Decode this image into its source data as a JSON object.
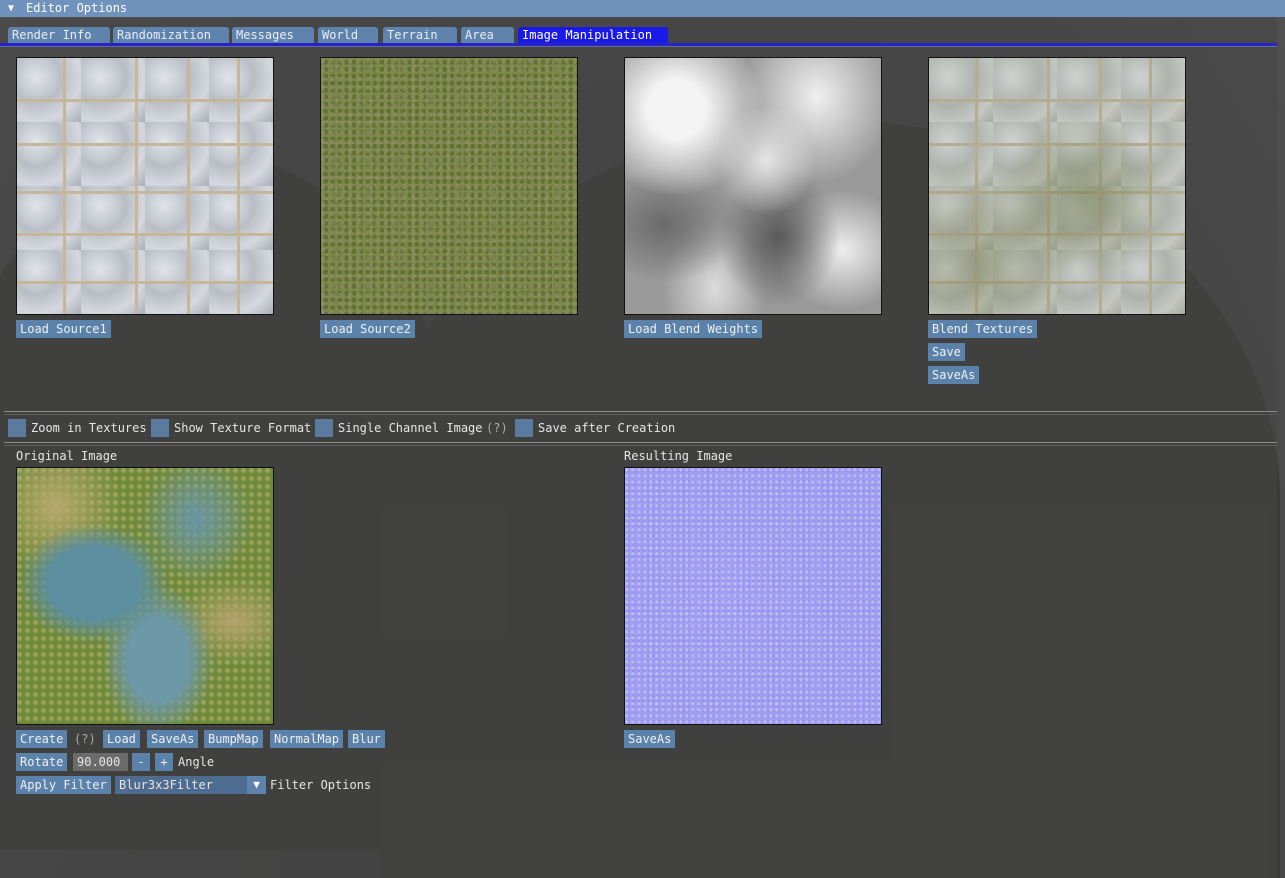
{
  "window": {
    "title": "Editor Options"
  },
  "tabs": [
    {
      "label": "Render Info",
      "active": false
    },
    {
      "label": "Randomization",
      "active": false
    },
    {
      "label": "Messages",
      "active": false
    },
    {
      "label": "World",
      "active": false
    },
    {
      "label": "Terrain",
      "active": false
    },
    {
      "label": "Area",
      "active": false
    },
    {
      "label": "Image Manipulation",
      "active": true
    }
  ],
  "blend": {
    "load_source1": "Load Source1",
    "load_source2": "Load Source2",
    "load_blend_weights": "Load Blend Weights",
    "blend_textures": "Blend Textures",
    "save": "Save",
    "save_as": "SaveAs"
  },
  "options": {
    "zoom_in_textures": "Zoom in Textures",
    "show_texture_format": "Show Texture Format",
    "single_channel_image": "Single Channel Image",
    "single_channel_help": "(?)",
    "save_after_creation": "Save after Creation"
  },
  "original": {
    "heading": "Original Image",
    "create": "Create",
    "create_help": "(?)",
    "load": "Load",
    "save_as": "SaveAs",
    "bump_map": "BumpMap",
    "normal_map": "NormalMap",
    "blur": "Blur",
    "rotate": "Rotate",
    "angle_value": "90.000",
    "minus": "-",
    "plus": "+",
    "angle_label": "Angle",
    "apply_filter": "Apply Filter",
    "filter_selected": "Blur3x3Filter",
    "filter_options_label": "Filter Options"
  },
  "result": {
    "heading": "Resulting Image",
    "save_as": "SaveAs"
  },
  "colors": {
    "title_bar": "#6f93bd",
    "active_tab": "#1a1ae8",
    "button": "#5a82ab"
  }
}
